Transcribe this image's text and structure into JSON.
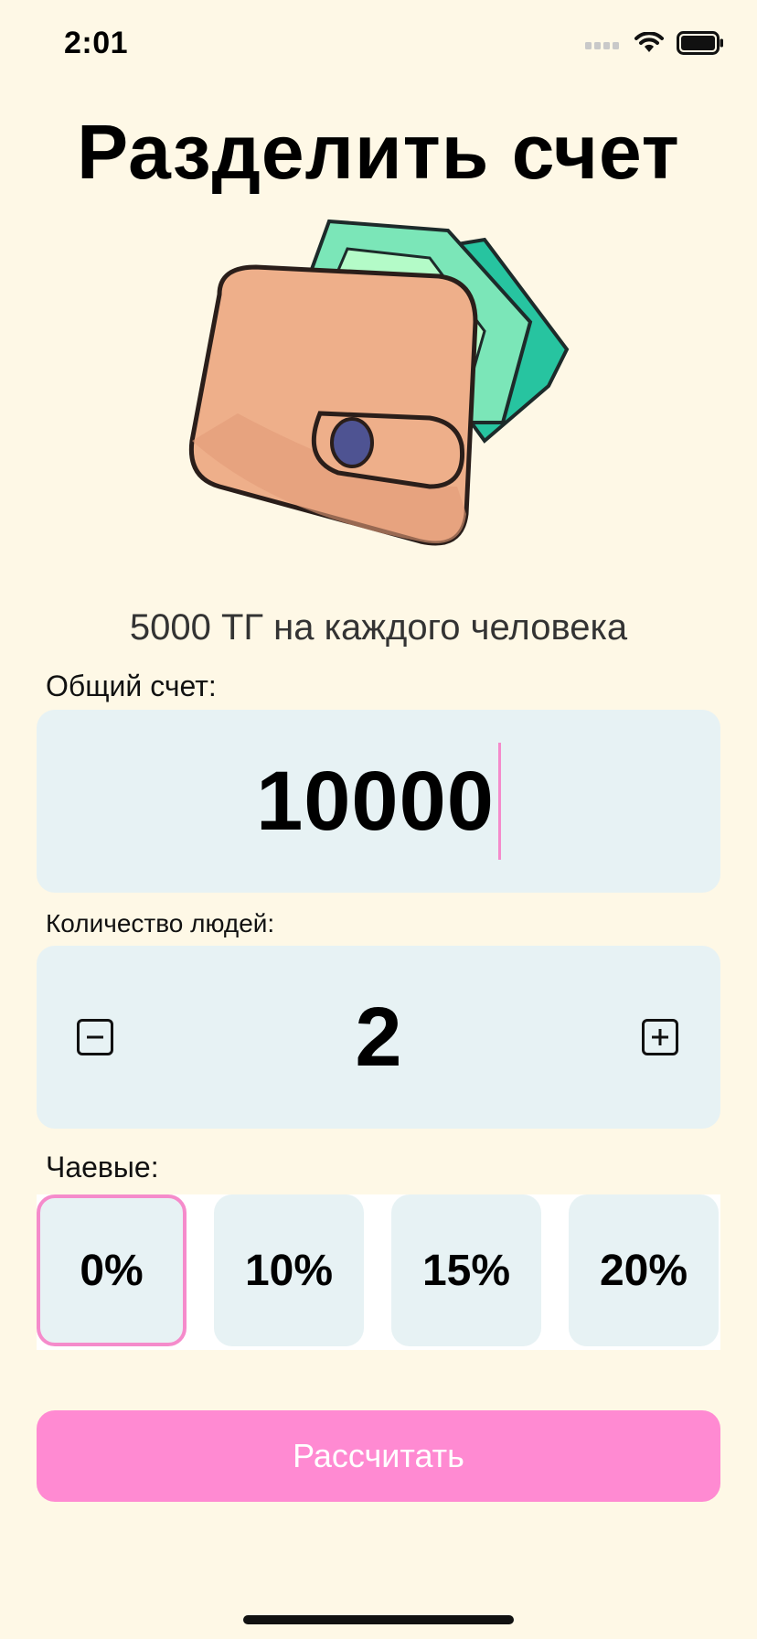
{
  "status_bar": {
    "time": "2:01"
  },
  "title": "Разделить счет",
  "per_person": "5000 ТГ на каждого человека",
  "total": {
    "label": "Общий счет:",
    "value": "10000"
  },
  "people": {
    "label": "Количество людей:",
    "count": "2"
  },
  "tips": {
    "label": "Чаевые:",
    "options": [
      "0%",
      "10%",
      "15%",
      "20%"
    ],
    "selected": "0%"
  },
  "calculate_label": "Рассчитать",
  "colors": {
    "background": "#FEF8E6",
    "card": "#E7F2F4",
    "accent": "#FF8AD2",
    "selection": "#F58BCB"
  }
}
